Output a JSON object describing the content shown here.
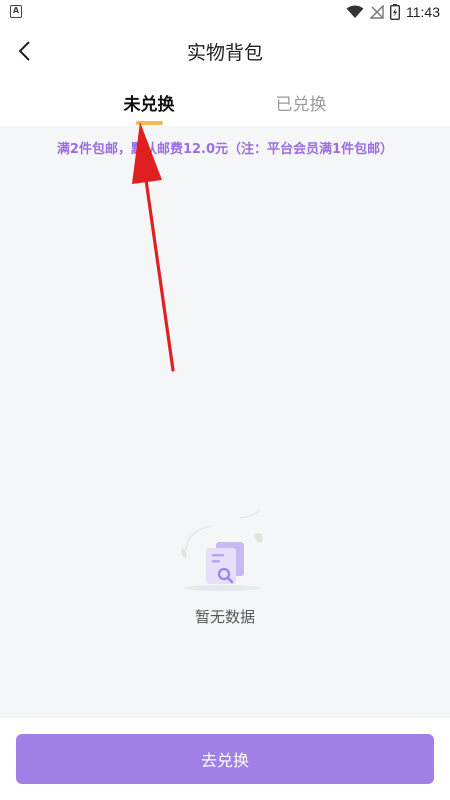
{
  "status_bar": {
    "left_icon_letter": "A",
    "time": "11:43",
    "icons": [
      "wifi-icon",
      "no-signal-icon",
      "battery-charging-icon"
    ]
  },
  "header": {
    "title": "实物背包",
    "back_icon": "chevron-left-icon"
  },
  "tabs": [
    {
      "label": "未兑换",
      "active": true
    },
    {
      "label": "已兑换",
      "active": false
    }
  ],
  "notice": "满2件包邮，默认邮费12.0元（注：平台会员满1件包邮）",
  "empty_state": {
    "text": "暂无数据",
    "icon": "empty-document-search-icon"
  },
  "bottom": {
    "button_label": "去兑换"
  },
  "colors": {
    "accent": "#a07fe6",
    "notice": "#9b6fe0",
    "tab_indicator": "#f5b84f",
    "annotation_arrow": "#e02020",
    "content_bg": "#f5f6f8"
  }
}
